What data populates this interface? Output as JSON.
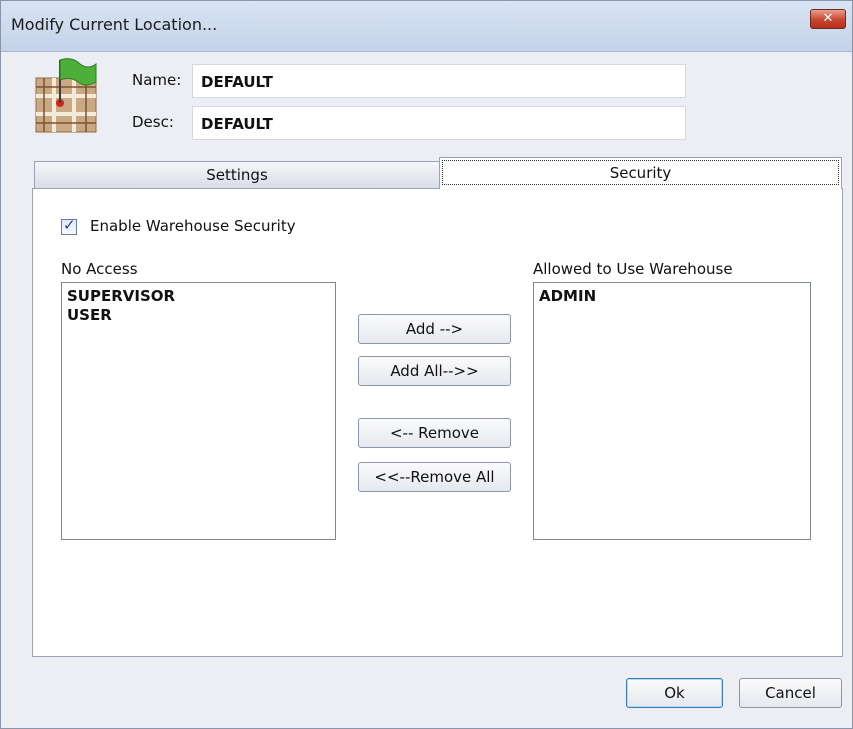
{
  "window": {
    "title": "Modify Current Location...",
    "close_icon": "close-x-icon"
  },
  "header": {
    "icon": "map-flag-icon",
    "name_label": "Name:",
    "name_value": "DEFAULT",
    "desc_label": "Desc:",
    "desc_value": "DEFAULT"
  },
  "tabs": [
    {
      "label": "Settings",
      "selected": false
    },
    {
      "label": "Security",
      "selected": true
    }
  ],
  "security": {
    "enable_label": "Enable Warehouse Security",
    "enable_checked": true,
    "no_access_label": "No Access",
    "no_access_items": [
      "SUPERVISOR",
      "USER"
    ],
    "allowed_label": "Allowed to Use Warehouse",
    "allowed_items": [
      "ADMIN"
    ],
    "add_label": "Add -->",
    "add_all_label": "Add All-->>",
    "remove_label": "<-- Remove",
    "remove_all_label": "<<--Remove All"
  },
  "footer": {
    "ok_label": "Ok",
    "cancel_label": "Cancel"
  },
  "colors": {
    "title_bar": "#c3d3e9",
    "close_button": "#c8452e",
    "dialog_bg": "#eceef3"
  }
}
